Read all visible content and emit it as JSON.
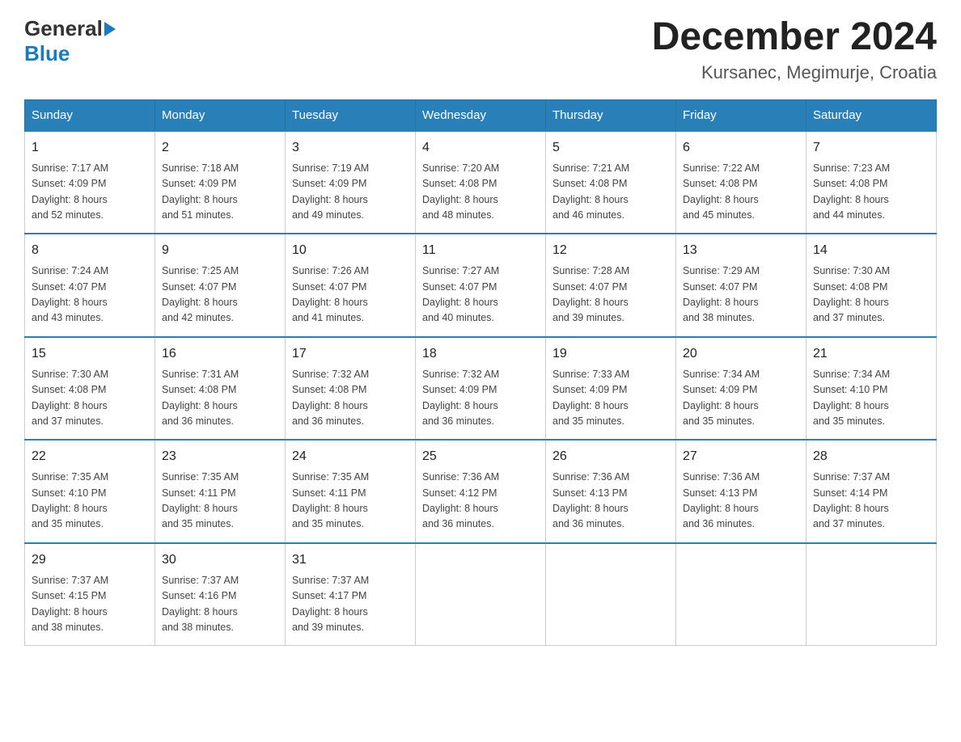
{
  "header": {
    "logo_general": "General",
    "logo_blue": "Blue",
    "title": "December 2024",
    "subtitle": "Kursanec, Megimurje, Croatia"
  },
  "days_of_week": [
    "Sunday",
    "Monday",
    "Tuesday",
    "Wednesday",
    "Thursday",
    "Friday",
    "Saturday"
  ],
  "weeks": [
    [
      {
        "day": "1",
        "info": "Sunrise: 7:17 AM\nSunset: 4:09 PM\nDaylight: 8 hours\nand 52 minutes."
      },
      {
        "day": "2",
        "info": "Sunrise: 7:18 AM\nSunset: 4:09 PM\nDaylight: 8 hours\nand 51 minutes."
      },
      {
        "day": "3",
        "info": "Sunrise: 7:19 AM\nSunset: 4:09 PM\nDaylight: 8 hours\nand 49 minutes."
      },
      {
        "day": "4",
        "info": "Sunrise: 7:20 AM\nSunset: 4:08 PM\nDaylight: 8 hours\nand 48 minutes."
      },
      {
        "day": "5",
        "info": "Sunrise: 7:21 AM\nSunset: 4:08 PM\nDaylight: 8 hours\nand 46 minutes."
      },
      {
        "day": "6",
        "info": "Sunrise: 7:22 AM\nSunset: 4:08 PM\nDaylight: 8 hours\nand 45 minutes."
      },
      {
        "day": "7",
        "info": "Sunrise: 7:23 AM\nSunset: 4:08 PM\nDaylight: 8 hours\nand 44 minutes."
      }
    ],
    [
      {
        "day": "8",
        "info": "Sunrise: 7:24 AM\nSunset: 4:07 PM\nDaylight: 8 hours\nand 43 minutes."
      },
      {
        "day": "9",
        "info": "Sunrise: 7:25 AM\nSunset: 4:07 PM\nDaylight: 8 hours\nand 42 minutes."
      },
      {
        "day": "10",
        "info": "Sunrise: 7:26 AM\nSunset: 4:07 PM\nDaylight: 8 hours\nand 41 minutes."
      },
      {
        "day": "11",
        "info": "Sunrise: 7:27 AM\nSunset: 4:07 PM\nDaylight: 8 hours\nand 40 minutes."
      },
      {
        "day": "12",
        "info": "Sunrise: 7:28 AM\nSunset: 4:07 PM\nDaylight: 8 hours\nand 39 minutes."
      },
      {
        "day": "13",
        "info": "Sunrise: 7:29 AM\nSunset: 4:07 PM\nDaylight: 8 hours\nand 38 minutes."
      },
      {
        "day": "14",
        "info": "Sunrise: 7:30 AM\nSunset: 4:08 PM\nDaylight: 8 hours\nand 37 minutes."
      }
    ],
    [
      {
        "day": "15",
        "info": "Sunrise: 7:30 AM\nSunset: 4:08 PM\nDaylight: 8 hours\nand 37 minutes."
      },
      {
        "day": "16",
        "info": "Sunrise: 7:31 AM\nSunset: 4:08 PM\nDaylight: 8 hours\nand 36 minutes."
      },
      {
        "day": "17",
        "info": "Sunrise: 7:32 AM\nSunset: 4:08 PM\nDaylight: 8 hours\nand 36 minutes."
      },
      {
        "day": "18",
        "info": "Sunrise: 7:32 AM\nSunset: 4:09 PM\nDaylight: 8 hours\nand 36 minutes."
      },
      {
        "day": "19",
        "info": "Sunrise: 7:33 AM\nSunset: 4:09 PM\nDaylight: 8 hours\nand 35 minutes."
      },
      {
        "day": "20",
        "info": "Sunrise: 7:34 AM\nSunset: 4:09 PM\nDaylight: 8 hours\nand 35 minutes."
      },
      {
        "day": "21",
        "info": "Sunrise: 7:34 AM\nSunset: 4:10 PM\nDaylight: 8 hours\nand 35 minutes."
      }
    ],
    [
      {
        "day": "22",
        "info": "Sunrise: 7:35 AM\nSunset: 4:10 PM\nDaylight: 8 hours\nand 35 minutes."
      },
      {
        "day": "23",
        "info": "Sunrise: 7:35 AM\nSunset: 4:11 PM\nDaylight: 8 hours\nand 35 minutes."
      },
      {
        "day": "24",
        "info": "Sunrise: 7:35 AM\nSunset: 4:11 PM\nDaylight: 8 hours\nand 35 minutes."
      },
      {
        "day": "25",
        "info": "Sunrise: 7:36 AM\nSunset: 4:12 PM\nDaylight: 8 hours\nand 36 minutes."
      },
      {
        "day": "26",
        "info": "Sunrise: 7:36 AM\nSunset: 4:13 PM\nDaylight: 8 hours\nand 36 minutes."
      },
      {
        "day": "27",
        "info": "Sunrise: 7:36 AM\nSunset: 4:13 PM\nDaylight: 8 hours\nand 36 minutes."
      },
      {
        "day": "28",
        "info": "Sunrise: 7:37 AM\nSunset: 4:14 PM\nDaylight: 8 hours\nand 37 minutes."
      }
    ],
    [
      {
        "day": "29",
        "info": "Sunrise: 7:37 AM\nSunset: 4:15 PM\nDaylight: 8 hours\nand 38 minutes."
      },
      {
        "day": "30",
        "info": "Sunrise: 7:37 AM\nSunset: 4:16 PM\nDaylight: 8 hours\nand 38 minutes."
      },
      {
        "day": "31",
        "info": "Sunrise: 7:37 AM\nSunset: 4:17 PM\nDaylight: 8 hours\nand 39 minutes."
      },
      {
        "day": "",
        "info": ""
      },
      {
        "day": "",
        "info": ""
      },
      {
        "day": "",
        "info": ""
      },
      {
        "day": "",
        "info": ""
      }
    ]
  ]
}
